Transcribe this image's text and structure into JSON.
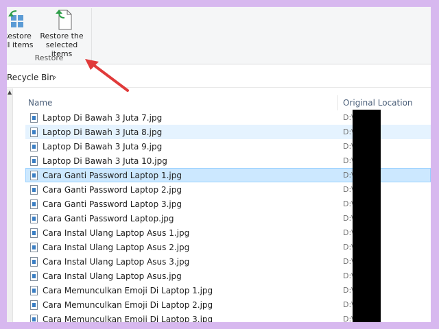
{
  "ribbon": {
    "restore_all_label": "Restore\nall items",
    "restore_selected_label": "Restore the\nselected items",
    "group_label": "Restore",
    "icons": {
      "restore_all": "restore-all-icon",
      "restore_selected": "restore-selected-icon"
    }
  },
  "address": {
    "crumb": "Recycle Bin",
    "chevron": "›"
  },
  "nav": {
    "up_arrow": "▲"
  },
  "columns": {
    "name": "Name",
    "original_location": "Original Location"
  },
  "files": [
    {
      "name": "Laptop Di Bawah 3 Juta 7.jpg",
      "location": "D:\\"
    },
    {
      "name": "Laptop Di Bawah 3 Juta 8.jpg",
      "location": "D:\\"
    },
    {
      "name": "Laptop Di Bawah 3 Juta 9.jpg",
      "location": "D:\\"
    },
    {
      "name": "Laptop Di Bawah 3 Juta 10.jpg",
      "location": "D:\\"
    },
    {
      "name": "Cara Ganti Password Laptop 1.jpg",
      "location": "D:\\"
    },
    {
      "name": "Cara Ganti Password Laptop 2.jpg",
      "location": "D:\\"
    },
    {
      "name": "Cara Ganti Password Laptop 3.jpg",
      "location": "D:\\"
    },
    {
      "name": "Cara Ganti Password Laptop.jpg",
      "location": "D:\\"
    },
    {
      "name": "Cara Instal Ulang Laptop Asus 1.jpg",
      "location": "D:\\"
    },
    {
      "name": "Cara Instal Ulang Laptop Asus 2.jpg",
      "location": "D:\\"
    },
    {
      "name": "Cara Instal Ulang Laptop Asus 3.jpg",
      "location": "D:\\"
    },
    {
      "name": "Cara Instal Ulang Laptop Asus.jpg",
      "location": "D:\\"
    },
    {
      "name": "Cara Memunculkan Emoji Di Laptop 1.jpg",
      "location": "D:\\"
    },
    {
      "name": "Cara Memunculkan Emoji Di Laptop 2.jpg",
      "location": "D:\\"
    },
    {
      "name": "Cara Memunculkan Emoji Di Laptop 3.jpg",
      "location": "D:\\"
    }
  ],
  "state": {
    "hover_row": 1,
    "selected_row": 4
  },
  "colors": {
    "frame": "#d7b8ef",
    "selection": "#cce8ff",
    "hover": "#e5f3ff",
    "arrow": "#e03a3a"
  }
}
